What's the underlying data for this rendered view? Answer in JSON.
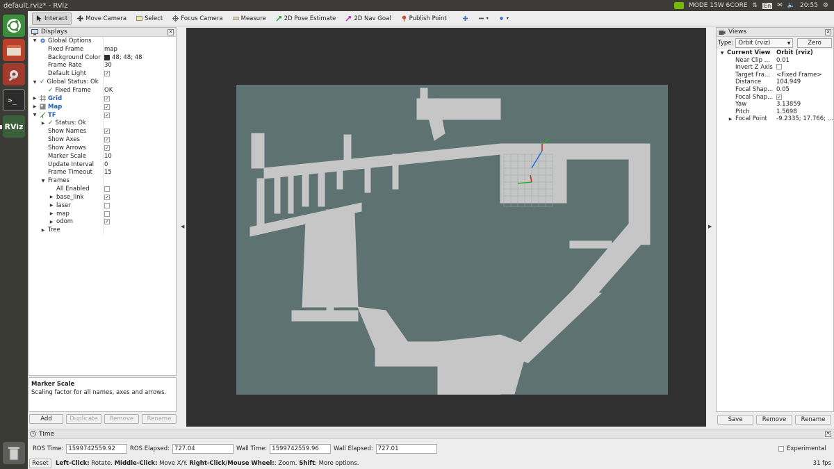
{
  "window": {
    "title": "default.rviz* - RViz"
  },
  "tray": {
    "mode": "MODE 15W 6CORE",
    "lang": "En",
    "time": "20:55"
  },
  "launcher": [
    {
      "name": "ubuntu-dash-icon"
    },
    {
      "name": "files-icon"
    },
    {
      "name": "settings-tool-icon"
    },
    {
      "name": "terminal-icon"
    },
    {
      "name": "rviz-app-icon",
      "label": "RViz"
    },
    {
      "name": "trash-icon"
    }
  ],
  "toolbar": {
    "tools": [
      {
        "label": "Interact",
        "icon": "cursor-icon",
        "active": true
      },
      {
        "label": "Move Camera",
        "icon": "move-camera-icon"
      },
      {
        "label": "Select",
        "icon": "select-icon"
      },
      {
        "label": "Focus Camera",
        "icon": "focus-icon"
      },
      {
        "label": "Measure",
        "icon": "ruler-icon"
      },
      {
        "label": "2D Pose Estimate",
        "icon": "pose-arrow-icon"
      },
      {
        "label": "2D Nav Goal",
        "icon": "nav-arrow-icon"
      },
      {
        "label": "Publish Point",
        "icon": "pin-icon"
      }
    ]
  },
  "displays": {
    "title": "Displays",
    "rows": [
      {
        "indent": 0,
        "arrow": "▼",
        "icon": "gear",
        "label": "Global Options",
        "value": ""
      },
      {
        "indent": 1,
        "label": "Fixed Frame",
        "value": "map"
      },
      {
        "indent": 1,
        "label": "Background Color",
        "value": "48; 48; 48",
        "swatch": true
      },
      {
        "indent": 1,
        "label": "Frame Rate",
        "value": "30"
      },
      {
        "indent": 1,
        "label": "Default Light",
        "check": true
      },
      {
        "indent": 0,
        "arrow": "▼",
        "icon": "ok",
        "label": "Global Status: Ok",
        "value": ""
      },
      {
        "indent": 1,
        "icon": "ok",
        "label": "Fixed Frame",
        "value": "OK"
      },
      {
        "indent": 0,
        "arrow": "▶",
        "icon": "grid",
        "label": "Grid",
        "blue": true,
        "check": true
      },
      {
        "indent": 0,
        "arrow": "▶",
        "icon": "map",
        "label": "Map",
        "blue": true,
        "check": true
      },
      {
        "indent": 0,
        "arrow": "▼",
        "icon": "tf",
        "label": "TF",
        "blue": true,
        "check": true
      },
      {
        "indent": 1,
        "arrow": "▶",
        "icon": "ok",
        "label": "Status: Ok",
        "value": ""
      },
      {
        "indent": 1,
        "label": "Show Names",
        "check": true
      },
      {
        "indent": 1,
        "label": "Show Axes",
        "check": true
      },
      {
        "indent": 1,
        "label": "Show Arrows",
        "check": true
      },
      {
        "indent": 1,
        "label": "Marker Scale",
        "value": "10"
      },
      {
        "indent": 1,
        "label": "Update Interval",
        "value": "0"
      },
      {
        "indent": 1,
        "label": "Frame Timeout",
        "value": "15"
      },
      {
        "indent": 1,
        "arrow": "▼",
        "label": "Frames",
        "value": ""
      },
      {
        "indent": 2,
        "label": "All Enabled",
        "check": false
      },
      {
        "indent": 2,
        "arrow": "▶",
        "label": "base_link",
        "check": true
      },
      {
        "indent": 2,
        "arrow": "▶",
        "label": "laser",
        "check": false
      },
      {
        "indent": 2,
        "arrow": "▶",
        "label": "map",
        "check": false
      },
      {
        "indent": 2,
        "arrow": "▶",
        "label": "odom",
        "check": true
      },
      {
        "indent": 1,
        "arrow": "▶",
        "label": "Tree",
        "value": ""
      }
    ],
    "description": {
      "title": "Marker Scale",
      "text": "Scaling factor for all names, axes and arrows."
    },
    "buttons": [
      {
        "label": "Add",
        "enabled": true
      },
      {
        "label": "Duplicate",
        "enabled": false
      },
      {
        "label": "Remove",
        "enabled": false
      },
      {
        "label": "Rename",
        "enabled": false
      }
    ]
  },
  "views": {
    "title": "Views",
    "type_label": "Type:",
    "type_value": "Orbit (rviz)",
    "zero_label": "Zero",
    "rows": [
      {
        "indent": 0,
        "arrow": "▼",
        "label": "Current View",
        "value": "Orbit (rviz)",
        "bold": true
      },
      {
        "indent": 1,
        "label": "Near Clip ...",
        "value": "0.01"
      },
      {
        "indent": 1,
        "label": "Invert Z Axis",
        "check": false
      },
      {
        "indent": 1,
        "label": "Target Fra...",
        "value": "<Fixed Frame>"
      },
      {
        "indent": 1,
        "label": "Distance",
        "value": "104.949"
      },
      {
        "indent": 1,
        "label": "Focal Shap...",
        "value": "0.05"
      },
      {
        "indent": 1,
        "label": "Focal Shap...",
        "check": true
      },
      {
        "indent": 1,
        "label": "Yaw",
        "value": "3.13859"
      },
      {
        "indent": 1,
        "label": "Pitch",
        "value": "1.5698"
      },
      {
        "indent": 1,
        "arrow": "▶",
        "label": "Focal Point",
        "value": "-9.2335; 17.766; ..."
      }
    ],
    "buttons": [
      {
        "label": "Save"
      },
      {
        "label": "Remove"
      },
      {
        "label": "Rename"
      }
    ]
  },
  "time": {
    "title": "Time",
    "ros_time_label": "ROS Time:",
    "ros_time": "1599742559.92",
    "ros_elapsed_label": "ROS Elapsed:",
    "ros_elapsed": "727.04",
    "wall_time_label": "Wall Time:",
    "wall_time": "1599742559.96",
    "wall_elapsed_label": "Wall Elapsed:",
    "wall_elapsed": "727.01",
    "experimental_label": "Experimental",
    "reset_label": "Reset",
    "hint": {
      "left_click": "Left-Click:",
      "left_click_text": " Rotate. ",
      "middle_click": "Middle-Click:",
      "middle_click_text": " Move X/Y. ",
      "right_click": "Right-Click/Mouse Wheel:",
      "right_click_text": ": Zoom. ",
      "shift": "Shift",
      "shift_text": ": More options."
    },
    "fps": "31 fps"
  }
}
